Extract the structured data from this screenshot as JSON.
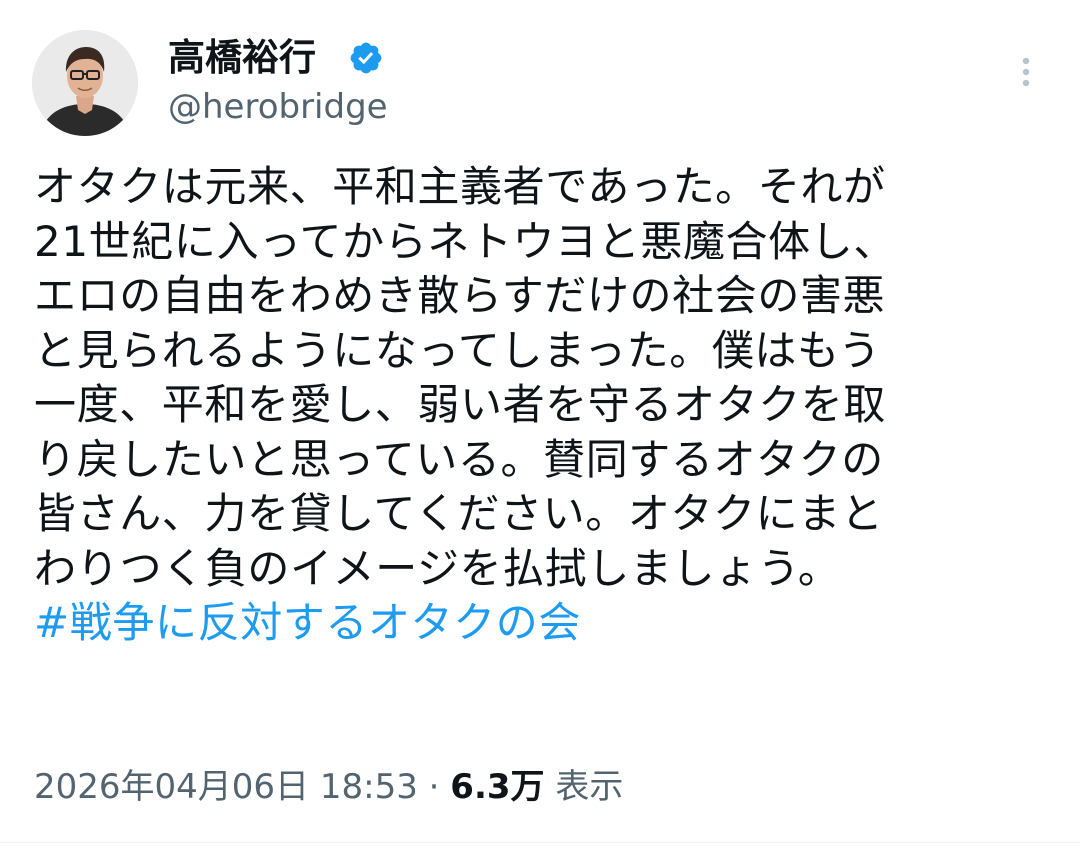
{
  "author": {
    "display_name": "高橋裕行",
    "handle": "@herobridge",
    "verified": true
  },
  "tweet": {
    "lines": [
      "オタクは元来、平和主義者であった。それが",
      "21世紀に入ってからネトウヨと悪魔合体し、",
      "エロの自由をわめき散らすだけの社会の害悪",
      "と見られるようになってしまった。僕はもう",
      "一度、平和を愛し、弱い者を守るオタクを取",
      "り戻したいと思っている。賛同するオタクの",
      "皆さん、力を貸してください。オタクにまと",
      "わりつく負のイメージを払拭しましょう。"
    ],
    "hashtag": "#戦争に反対するオタクの会"
  },
  "meta": {
    "timestamp": "2026年04月06日 18:53",
    "separator": " · ",
    "views_count": "6.3万",
    "views_label": " 表示"
  },
  "colors": {
    "text": "#0f1419",
    "secondary": "#536471",
    "link": "#1d9bf0",
    "verified": "#1d9bf0"
  },
  "icons": {
    "verified": "verified-badge-icon",
    "more": "more-vertical-icon"
  }
}
